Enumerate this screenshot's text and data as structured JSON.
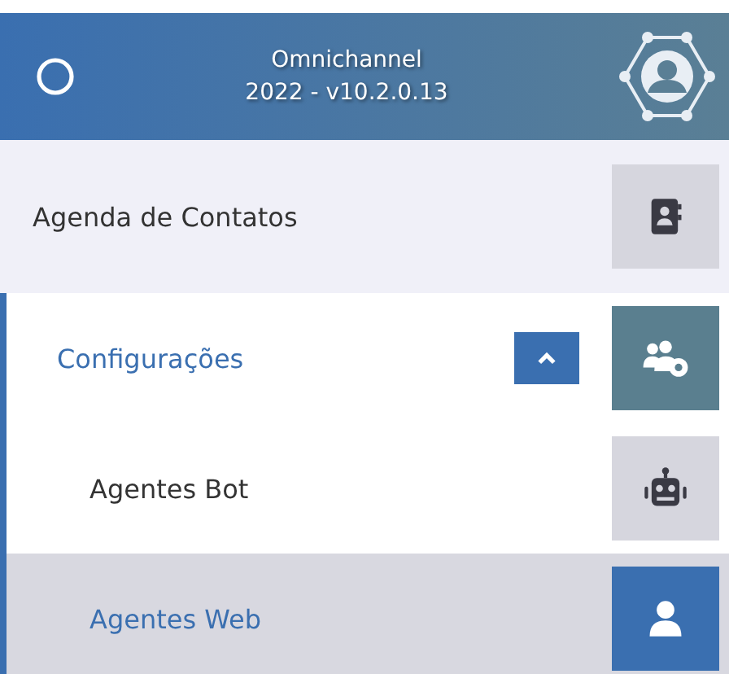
{
  "header": {
    "title": "Omnichannel",
    "version": "2022 - v10.2.0.13"
  },
  "menu": [
    {
      "label": "Agenda de Contatos",
      "selected": false
    },
    {
      "label": "Configurações",
      "selected": false,
      "expanded": true,
      "children": [
        {
          "label": "Agentes Bot",
          "selected": false
        },
        {
          "label": "Agentes Web",
          "selected": true
        }
      ]
    }
  ]
}
